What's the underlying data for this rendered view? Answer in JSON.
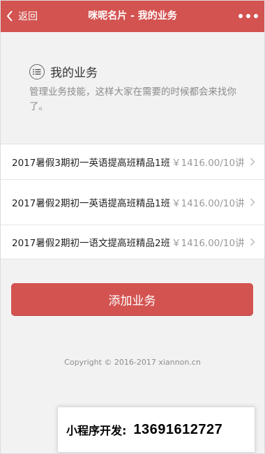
{
  "navbar": {
    "back_label": "返回",
    "title": "咪呢名片 - 我的业务",
    "more_icon": "more-dots-icon",
    "back_icon": "chevron-left-icon",
    "bg_color": "#d35350"
  },
  "section": {
    "icon": "list-icon",
    "title": "我的业务",
    "description": "管理业务技能，这样大家在需要的时候都会来找你了。"
  },
  "services": [
    {
      "name": "2017暑假3期初一英语提高班精品1班",
      "price": "￥1416.00/10讲"
    },
    {
      "name": "2017暑假2期初一英语提高班精品1班",
      "price": "￥1416.00/10讲"
    },
    {
      "name": "2017暑假2期初一语文提高班精品2班",
      "price": "￥1416.00/10讲"
    }
  ],
  "add_button_label": "添加业务",
  "footer": {
    "copyright": "Copyright © 2016-2017 xiannon.cn"
  },
  "promo": {
    "label": "小程序开发:",
    "phone": "13691612727"
  }
}
